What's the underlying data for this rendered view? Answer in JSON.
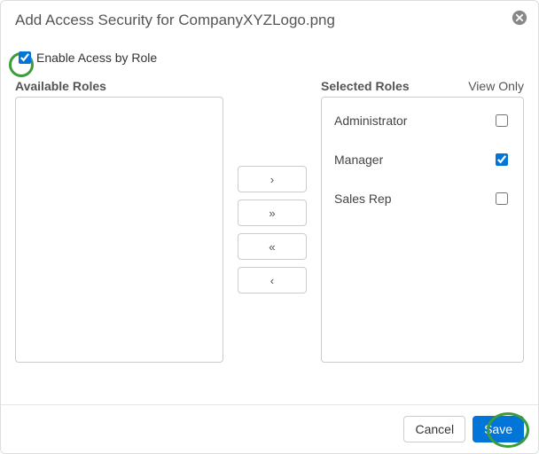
{
  "dialog": {
    "title": "Add Access Security for CompanyXYZLogo.png",
    "enable_label": "Enable Acess by Role",
    "enable_checked": true
  },
  "roles": {
    "available_header": "Available Roles",
    "selected_header": "Selected Roles",
    "view_only_header": "View Only",
    "available": [],
    "selected": [
      {
        "name": "Administrator",
        "view_only": false
      },
      {
        "name": "Manager",
        "view_only": true
      },
      {
        "name": "Sales Rep",
        "view_only": false
      }
    ]
  },
  "transfer": {
    "add_one": "›",
    "add_all": "»",
    "remove_all": "«",
    "remove_one": "‹"
  },
  "footer": {
    "cancel": "Cancel",
    "save": "Save"
  },
  "colors": {
    "primary": "#0275d8",
    "annotation": "#3b9c3b"
  }
}
